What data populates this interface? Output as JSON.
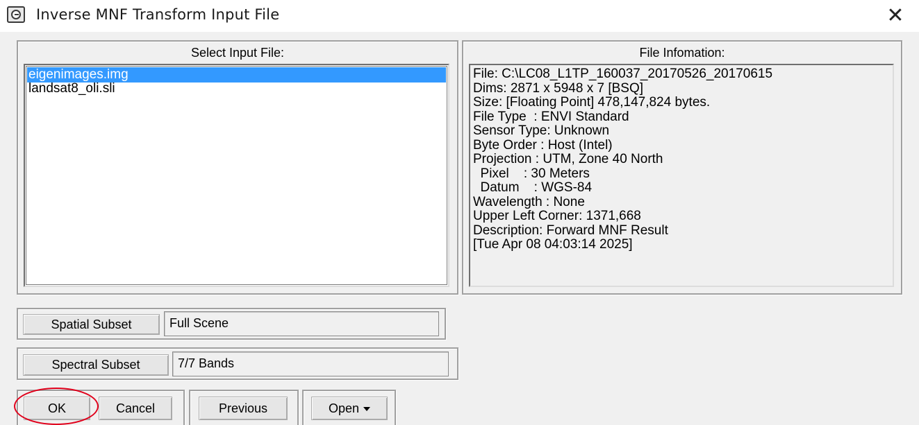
{
  "window": {
    "title": "Inverse MNF Transform Input File",
    "close_label": "✕",
    "icon": "app-window-icon"
  },
  "select_input": {
    "title": "Select Input File:",
    "files": [
      "eigenimages.img",
      "landsat8_oli.sli"
    ],
    "selected_index": 0
  },
  "file_info": {
    "title": "File Infomation:",
    "lines": [
      "File: C:\\LC08_L1TP_160037_20170526_20170615",
      "Dims: 2871 x 5948 x 7 [BSQ]",
      "Size: [Floating Point] 478,147,824 bytes.",
      "File Type  : ENVI Standard",
      "Sensor Type: Unknown",
      "Byte Order : Host (Intel)",
      "Projection : UTM, Zone 40 North",
      "  Pixel    : 30 Meters",
      "  Datum    : WGS-84",
      "Wavelength : None",
      "Upper Left Corner: 1371,668",
      "Description: Forward MNF Result",
      "[Tue Apr 08 04:03:14 2025]"
    ]
  },
  "spatial_subset": {
    "button_label": "Spatial Subset",
    "value": "Full Scene"
  },
  "spectral_subset": {
    "button_label": "Spectral Subset",
    "value": "7/7 Bands"
  },
  "buttons": {
    "ok": "OK",
    "cancel": "Cancel",
    "previous": "Previous",
    "open": "Open"
  },
  "colors": {
    "selection": "#3399ff",
    "highlight_circle": "#e0001b"
  }
}
